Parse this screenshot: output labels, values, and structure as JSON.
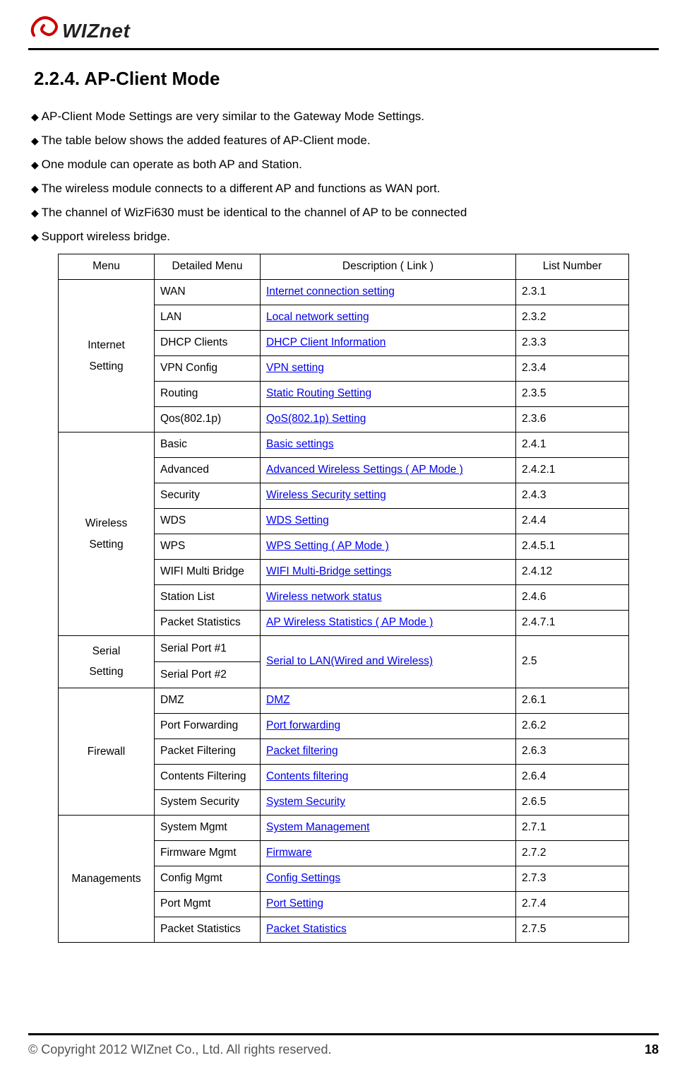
{
  "logo_text": "WIZnet",
  "section_title": "2.2.4.  AP-Client  Mode",
  "bullets": [
    "AP-Client Mode Settings are very similar to the Gateway Mode Settings.",
    "The table below shows the added features of AP-Client mode.",
    "One module can operate as both AP and Station.",
    "The wireless module connects to a different AP and functions as WAN port.",
    "The channel of WizFi630 must be identical to the channel of AP to be connected",
    "Support wireless bridge."
  ],
  "headers": {
    "menu": "Menu",
    "detailed": "Detailed Menu",
    "desc": "Description ( Link )",
    "list": "List Number"
  },
  "groups": [
    {
      "menu": "Internet\nSetting",
      "rows": [
        {
          "detailed": "WAN",
          "desc": "Internet connection setting",
          "list": "2.3.1"
        },
        {
          "detailed": "LAN",
          "desc": "Local network setting",
          "list": "2.3.2"
        },
        {
          "detailed": "DHCP Clients",
          "desc": "DHCP Client Information",
          "list": "2.3.3"
        },
        {
          "detailed": "VPN Config",
          "desc": "VPN setting",
          "list": "2.3.4"
        },
        {
          "detailed": "Routing",
          "desc": "Static Routing Setting",
          "list": "2.3.5"
        },
        {
          "detailed": "Qos(802.1p)",
          "desc": "QoS(802.1p) Setting",
          "list": "2.3.6"
        }
      ]
    },
    {
      "menu": "Wireless\nSetting",
      "rows": [
        {
          "detailed": "Basic",
          "desc": "Basic settings",
          "list": "2.4.1"
        },
        {
          "detailed": "Advanced",
          "desc": "Advanced Wireless Settings ( AP Mode )",
          "list": "2.4.2.1"
        },
        {
          "detailed": "Security",
          "desc": "Wireless Security setting",
          "list": "2.4.3"
        },
        {
          "detailed": "WDS",
          "desc": "WDS Setting",
          "list": "2.4.4"
        },
        {
          "detailed": "WPS",
          "desc": "WPS Setting ( AP Mode )",
          "list": "2.4.5.1"
        },
        {
          "detailed": "WIFI Multi Bridge",
          "desc": "WIFI Multi-Bridge settings",
          "list": "2.4.12"
        },
        {
          "detailed": "Station List",
          "desc": "Wireless network status",
          "list": "2.4.6"
        },
        {
          "detailed": "Packet Statistics",
          "desc": "AP Wireless Statistics ( AP Mode )",
          "list": "2.4.7.1"
        }
      ]
    },
    {
      "menu": "Serial\nSetting",
      "merged_desc": "Serial to LAN(Wired and Wireless)",
      "merged_list": "2.5",
      "rows": [
        {
          "detailed": "Serial Port #1"
        },
        {
          "detailed": "Serial Port #2"
        }
      ]
    },
    {
      "menu": "Firewall",
      "rows": [
        {
          "detailed": "DMZ",
          "desc": "DMZ",
          "list": "2.6.1"
        },
        {
          "detailed": "Port Forwarding",
          "desc": "Port forwarding",
          "list": "2.6.2"
        },
        {
          "detailed": "Packet Filtering",
          "desc": "Packet filtering",
          "list": "2.6.3"
        },
        {
          "detailed": "Contents Filtering",
          "desc": "Contents filtering",
          "list": "2.6.4"
        },
        {
          "detailed": "System Security",
          "desc": "System Security",
          "list": "2.6.5"
        }
      ]
    },
    {
      "menu": "Managements",
      "rows": [
        {
          "detailed": "System Mgmt",
          "desc": "System Management",
          "list": "2.7.1"
        },
        {
          "detailed": "Firmware Mgmt",
          "desc": "Firmware",
          "list": "2.7.2"
        },
        {
          "detailed": "Config Mgmt",
          "desc": "Config Settings",
          "list": "2.7.3"
        },
        {
          "detailed": "Port Mgmt",
          "desc": "Port Setting",
          "list": "2.7.4"
        },
        {
          "detailed": "Packet Statistics",
          "desc": "Packet Statistics",
          "list": "2.7.5"
        }
      ]
    }
  ],
  "footer": {
    "copyright": "© Copyright 2012 WIZnet Co., Ltd. All rights reserved.",
    "page": "18"
  }
}
